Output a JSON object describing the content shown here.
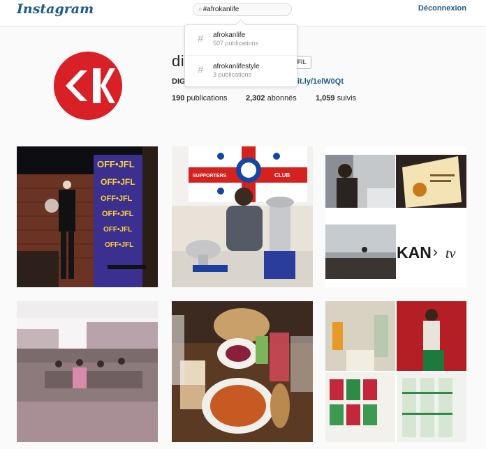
{
  "topbar": {
    "logo": "Instagram",
    "search_value": "#afrokanlife",
    "logout": "Déconnexion"
  },
  "search_dropdown": [
    {
      "name": "afrokanlife",
      "count": "507 publications"
    },
    {
      "name": "afrokanlifestyle",
      "count": "3 publications"
    }
  ],
  "profile": {
    "username": "dig",
    "follow_button": "FIL",
    "full_name": "DIG",
    "bio_link": "it.ly/1elW0Qt",
    "posts_count": "190",
    "posts_label": "publications",
    "followers_count": "2,302",
    "followers_label": "abonnés",
    "following_count": "1,059",
    "following_label": "suivis"
  },
  "photos": {
    "p1_texts": [
      "OFF•JFL",
      "OFF•JFL",
      "OFF•JFL",
      "OFF•JFL",
      "OFF•JFL",
      "OFF•JFL"
    ],
    "p2_banner_left": "SUPPORTERS",
    "p2_banner_right": "CLUB",
    "p3_logo_left": "KAN",
    "p3_logo_right": "tv"
  },
  "colors": {
    "brand_blue": "#1e5a8c",
    "avatar_red": "#d92027"
  }
}
